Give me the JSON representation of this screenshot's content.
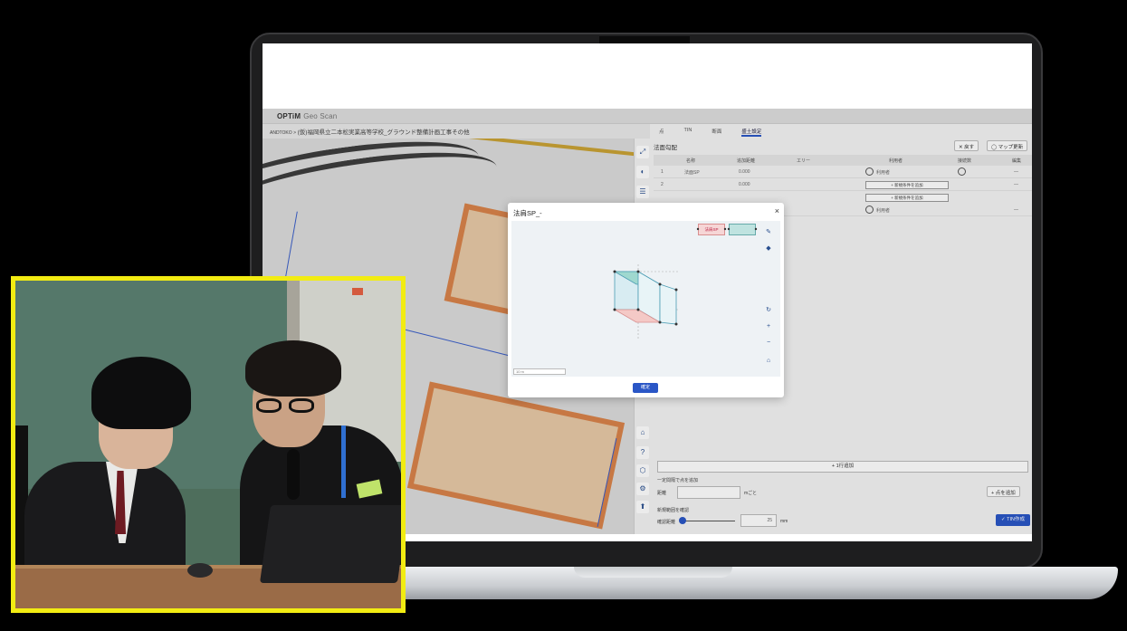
{
  "app": {
    "brand_bold": "OPTiM",
    "brand_rest": "Geo Scan",
    "breadcrumb_root": "ANDTOKO",
    "breadcrumb_sep": ">",
    "breadcrumb_project": "(仮)福岡県立二本松実業高等学校_グラウンド整備計画工事その他"
  },
  "panel": {
    "tabs": [
      {
        "label": "点"
      },
      {
        "label": "TIN"
      },
      {
        "label": "断面"
      },
      {
        "label": "盛土設定"
      }
    ],
    "title": "法面勾配",
    "btn_revert": "✕ 戻す",
    "btn_map": "◯ マップ更新",
    "columns": [
      "",
      "名称",
      "追加距離",
      "エリー",
      "",
      "利用者",
      "接続数",
      "編集"
    ],
    "rows": [
      {
        "no": "1",
        "name": "法面SP",
        "dist": "0.000",
        "user": "利用者"
      },
      {
        "no": "2",
        "name": "",
        "dist": "0.000",
        "user": ""
      },
      {
        "no": "",
        "name": "",
        "dist": "",
        "user": "利用者"
      }
    ],
    "add_condition": "+ 新規条件を追加",
    "add_row": "+ 1行追加",
    "section_add_label": "一定間隔で点を追加",
    "field_count_label": "距離",
    "field_unit": "mごと",
    "add_point_btn": "+ 点を追加",
    "range_title": "新規範囲を確認",
    "slider_label": "確認距離",
    "slider_value": "25",
    "slider_unit": "mm",
    "tin_btn": "✓ TIN作成"
  },
  "dialog": {
    "title": "法肩SP_-",
    "close": "×",
    "legend_red": "法肩SP",
    "scale_text": "10 m",
    "ok_label": "確定"
  },
  "icons": [
    "expand-icon",
    "layer-icon",
    "stack-icon",
    "home-icon",
    "help-icon",
    "cube-icon",
    "settings-icon",
    "upload-icon",
    "rotate-icon",
    "plus-icon",
    "minus-icon",
    "eraser-icon",
    "ruler-icon"
  ]
}
